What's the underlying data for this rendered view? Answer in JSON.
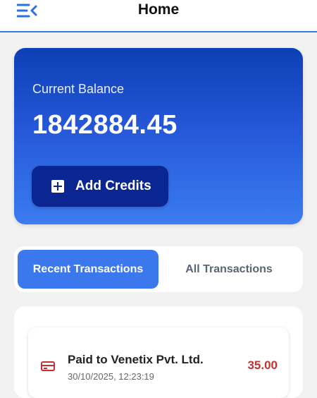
{
  "header": {
    "title": "Home",
    "menu_icon": "menu-collapse-icon"
  },
  "balance": {
    "label": "Current Balance",
    "value": "1842884.45",
    "add_button_label": "Add Credits",
    "add_button_icon": "plus-square-icon"
  },
  "tabs": [
    {
      "label": "Recent Transactions",
      "active": true
    },
    {
      "label": "All Transactions",
      "active": false
    }
  ],
  "transactions": [
    {
      "title": "Paid to Venetix Pvt. Ltd.",
      "datetime": "30/10/2025, 12:23:19",
      "amount": "35.00",
      "icon": "payment-card-icon"
    }
  ],
  "colors": {
    "accent": "#3b78ed",
    "card_gradient_top": "#0d3fb5",
    "card_gradient_bottom": "#3b7cf0",
    "button_dark": "#0b2591",
    "debit": "#c53030"
  }
}
